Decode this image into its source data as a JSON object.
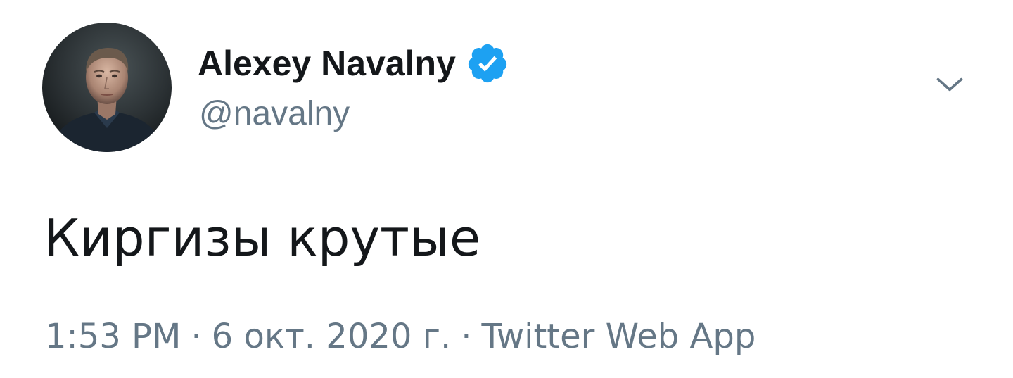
{
  "author": {
    "name": "Alexey Navalny",
    "handle": "@navalny",
    "verified": true,
    "verified_color": "#1da1f2"
  },
  "tweet": {
    "text": "Киргизы крутые"
  },
  "meta": {
    "time": "1:53 PM",
    "separator": "·",
    "date": "6 окт. 2020 г.",
    "source": "Twitter Web App"
  },
  "colors": {
    "text_primary": "#14171a",
    "text_secondary": "#657786",
    "accent": "#1da1f2"
  },
  "icons": {
    "avatar": "profile-photo",
    "verified": "verified-badge-icon",
    "menu": "chevron-down-icon"
  }
}
